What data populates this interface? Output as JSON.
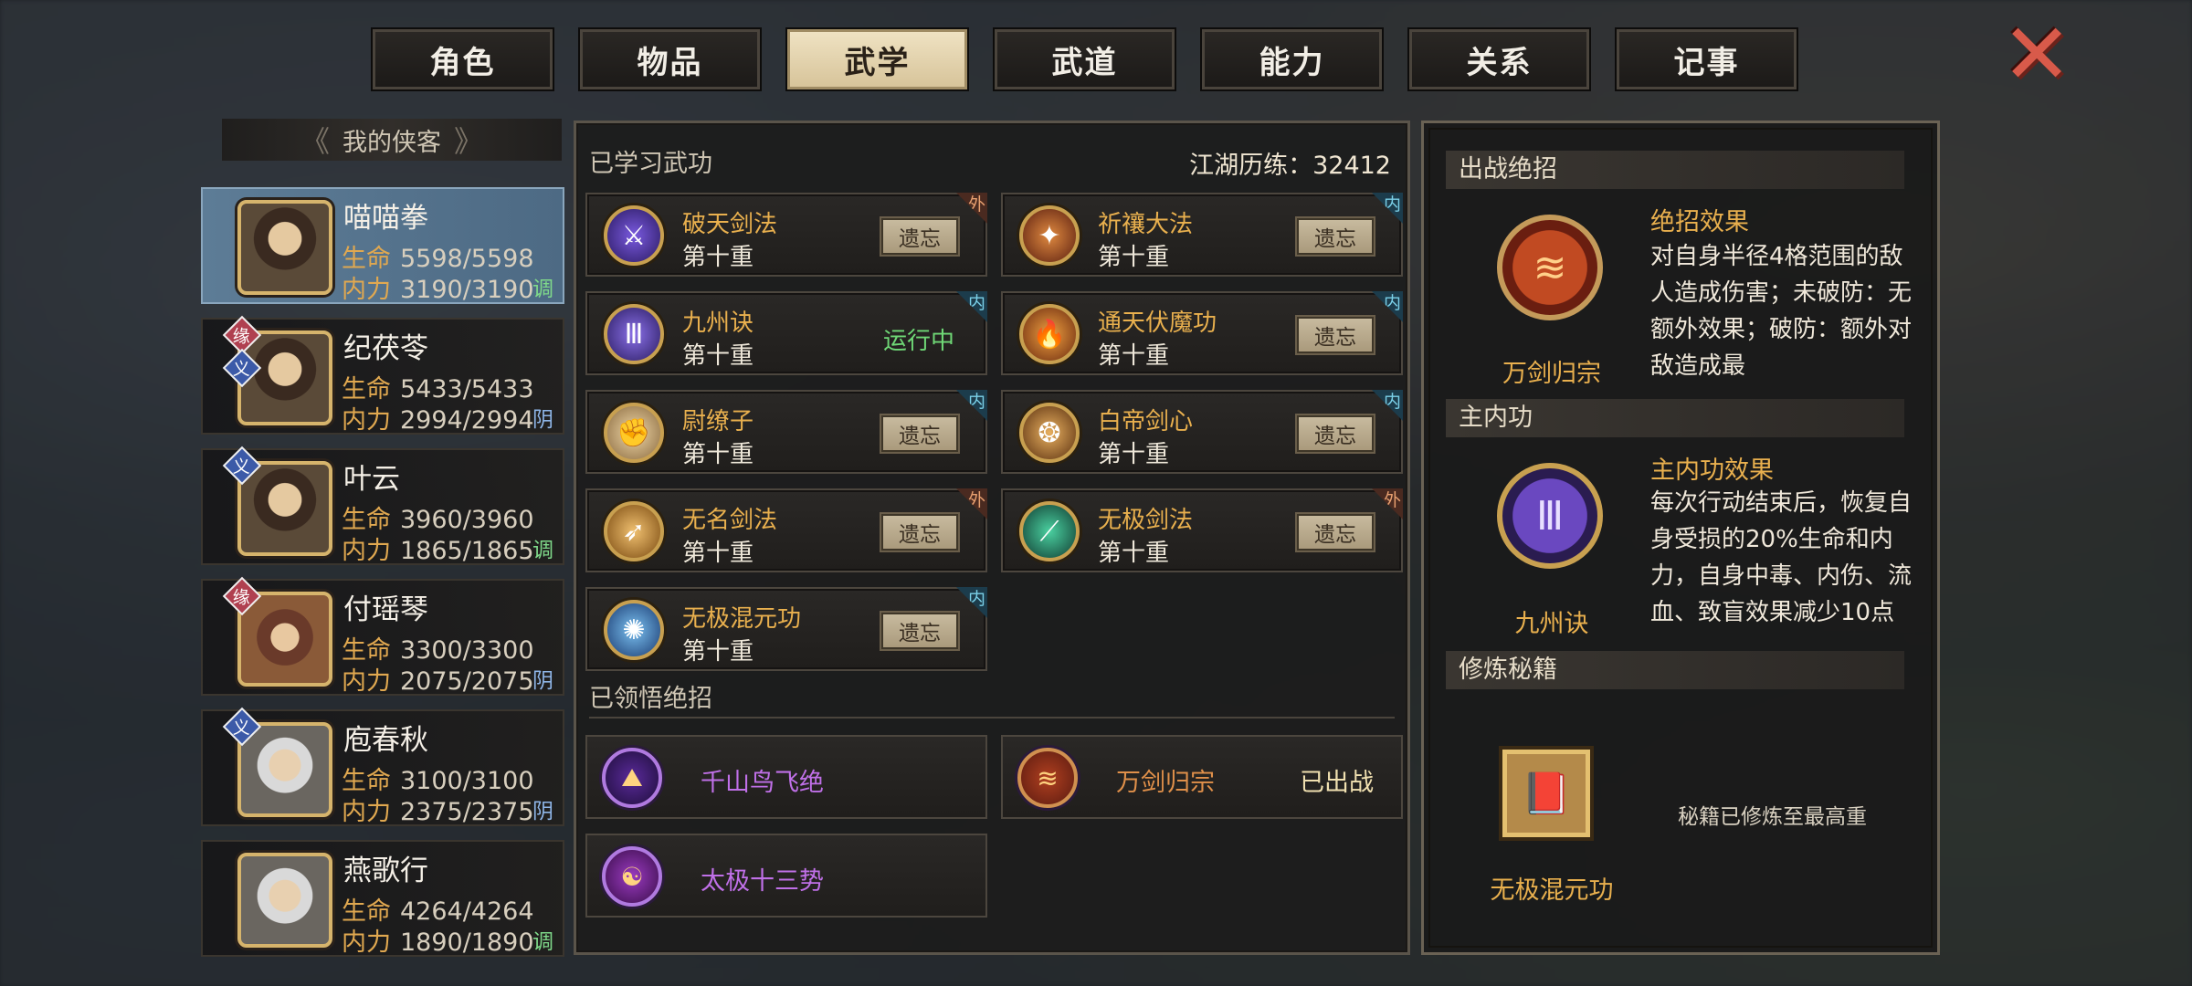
{
  "tabs": [
    {
      "label": "角色"
    },
    {
      "label": "物品"
    },
    {
      "label": "武学"
    },
    {
      "label": "武道"
    },
    {
      "label": "能力"
    },
    {
      "label": "关系"
    },
    {
      "label": "记事"
    }
  ],
  "active_tab": "武学",
  "close_icon": "close-icon",
  "roster": {
    "title": "我的侠客",
    "heroes": [
      {
        "name": "喵喵拳",
        "hp_label": "生命",
        "hp": "5598/5598",
        "mp_label": "内力",
        "mp": "3190/3190",
        "attr": "调",
        "tags": []
      },
      {
        "name": "纪茯苓",
        "hp_label": "生命",
        "hp": "5433/5433",
        "mp_label": "内力",
        "mp": "2994/2994",
        "attr": "阴",
        "tags": [
          "缘",
          "义"
        ]
      },
      {
        "name": "叶云",
        "hp_label": "生命",
        "hp": "3960/3960",
        "mp_label": "内力",
        "mp": "1865/1865",
        "attr": "调",
        "tags": [
          "义"
        ]
      },
      {
        "name": "付瑶琴",
        "hp_label": "生命",
        "hp": "3300/3300",
        "mp_label": "内力",
        "mp": "2075/2075",
        "attr": "阴",
        "tags": [
          "缘"
        ]
      },
      {
        "name": "庖春秋",
        "hp_label": "生命",
        "hp": "3100/3100",
        "mp_label": "内力",
        "mp": "2375/2375",
        "attr": "阴",
        "tags": [
          "义"
        ]
      },
      {
        "name": "燕歌行",
        "hp_label": "生命",
        "hp": "4264/4264",
        "mp_label": "内力",
        "mp": "1890/1890",
        "attr": "调",
        "tags": []
      }
    ]
  },
  "learned": {
    "title": "已学习武功",
    "jianghu_label": "江湖历练：32412",
    "forget_label": "遗忘",
    "running_label": "运行中",
    "skills": [
      {
        "name": "破天剑法",
        "level": "第十重",
        "type": "外",
        "action": "forget"
      },
      {
        "name": "祈禳大法",
        "level": "第十重",
        "type": "内",
        "action": "forget"
      },
      {
        "name": "九州诀",
        "level": "第十重",
        "type": "内",
        "action": "running"
      },
      {
        "name": "通天伏魔功",
        "level": "第十重",
        "type": "内",
        "action": "forget"
      },
      {
        "name": "尉缭子",
        "level": "第十重",
        "type": "内",
        "action": "forget"
      },
      {
        "name": "白帝剑心",
        "level": "第十重",
        "type": "内",
        "action": "forget"
      },
      {
        "name": "无名剑法",
        "level": "第十重",
        "type": "外",
        "action": "forget"
      },
      {
        "name": "无极剑法",
        "level": "第十重",
        "type": "外",
        "action": "forget"
      },
      {
        "name": "无极混元功",
        "level": "第十重",
        "type": "内",
        "action": "forget"
      }
    ]
  },
  "ultimates": {
    "title": "已领悟绝招",
    "items": [
      {
        "name": "千山鸟飞绝",
        "status": ""
      },
      {
        "name": "万剑归宗",
        "status": "已出战"
      },
      {
        "name": "太极十三势",
        "status": ""
      }
    ]
  },
  "right": {
    "battle": {
      "header": "出战绝招",
      "name": "万剑归宗",
      "effect_title": "绝招效果",
      "effect_text": "对自身半径4格范围的敌人造成伤害；未破防：无额外效果；破防：额外对敌造成最"
    },
    "inner": {
      "header": "主内功",
      "name": "九州诀",
      "effect_title": "主内功效果",
      "effect_text": "每次行动结束后，恢复自身受损的20%生命和内力，自身中毒、内伤、流血、致盲效果减少10点"
    },
    "manual": {
      "header": "修炼秘籍",
      "name": "无极混元功",
      "note": "秘籍已修炼至最高重"
    }
  },
  "colors": {
    "gold": "#e9b04e",
    "purple": "#c070e8",
    "green": "#6fd876",
    "active_row": "#5d7c96"
  }
}
